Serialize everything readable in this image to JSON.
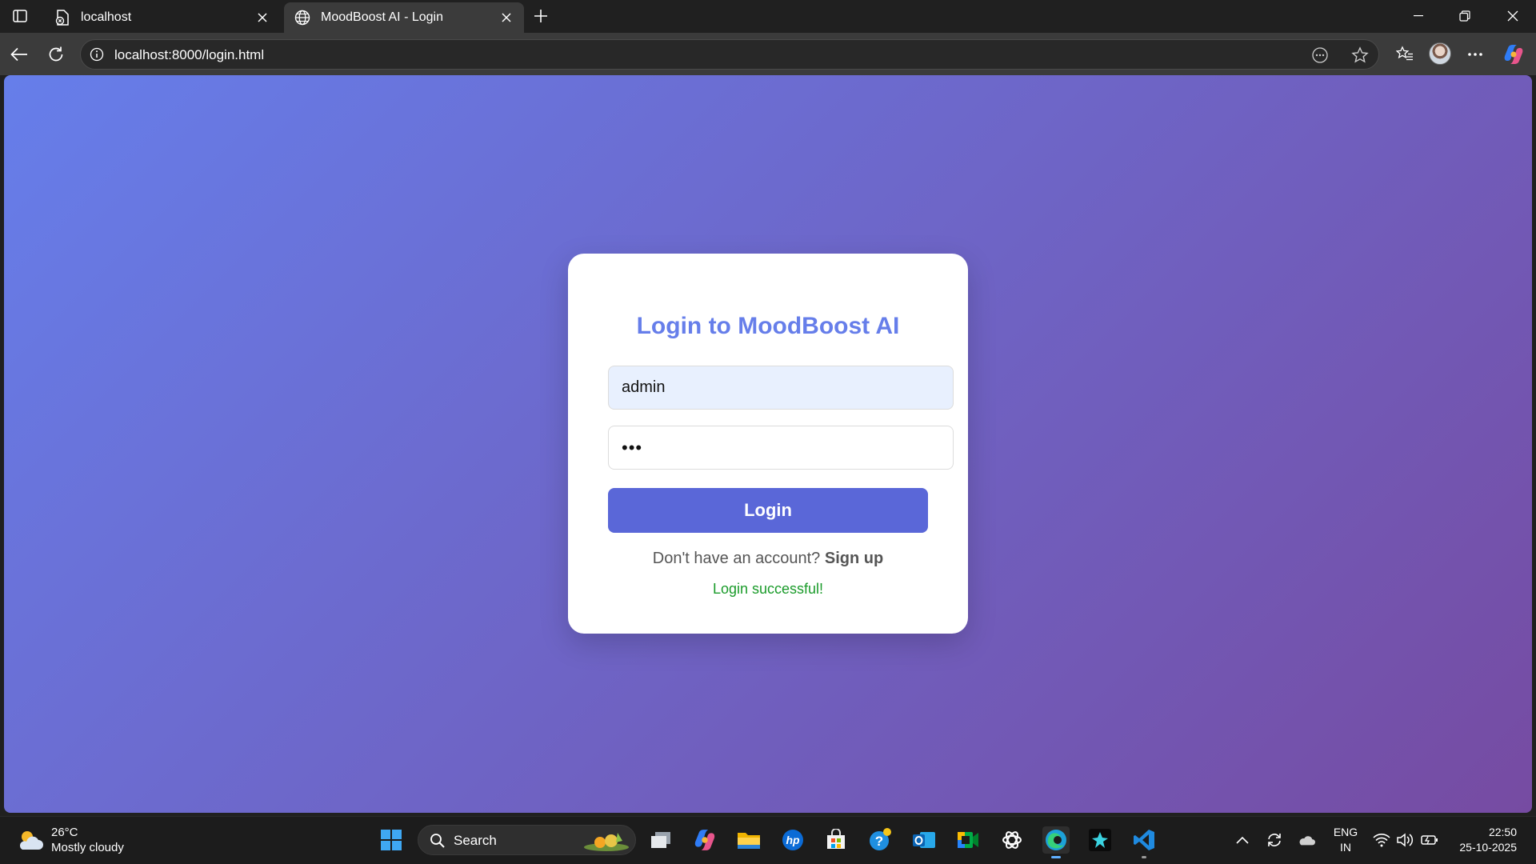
{
  "browser": {
    "tabs": [
      {
        "title": "localhost",
        "active": false
      },
      {
        "title": "MoodBoost AI - Login",
        "active": true
      }
    ],
    "url": "localhost:8000/login.html"
  },
  "page": {
    "heading": "Login to MoodBoost AI",
    "username_value": "admin",
    "password_value": "•••",
    "login_label": "Login",
    "signup_prompt": "Don't have an account?",
    "signup_link": "Sign up",
    "status_message": "Login successful!",
    "colors": {
      "gradient_start": "#667eea",
      "gradient_end": "#764ba2",
      "accent": "#5a67d8",
      "success": "#1a9b2a"
    }
  },
  "taskbar": {
    "weather_temp": "26°C",
    "weather_desc": "Mostly cloudy",
    "search_label": "Search",
    "language_line1": "ENG",
    "language_line2": "IN",
    "time": "22:50",
    "date": "25-10-2025",
    "apps": [
      "start-icon",
      "task-view-icon",
      "copilot-icon",
      "file-explorer-icon",
      "hp-icon",
      "store-icon",
      "help-icon",
      "outlook-icon",
      "meet-icon",
      "chatgpt-icon",
      "edge-icon",
      "app-icon",
      "vscode-icon"
    ]
  }
}
